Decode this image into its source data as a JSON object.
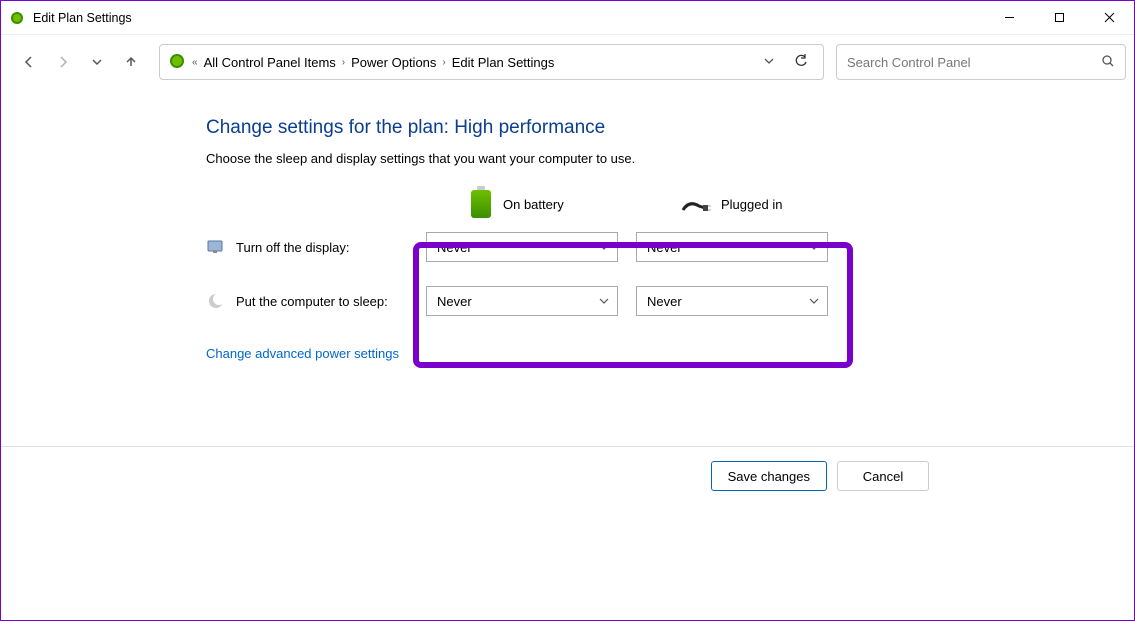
{
  "window": {
    "title": "Edit Plan Settings"
  },
  "breadcrumb": {
    "item1": "All Control Panel Items",
    "item2": "Power Options",
    "item3": "Edit Plan Settings"
  },
  "search": {
    "placeholder": "Search Control Panel"
  },
  "page": {
    "heading": "Change settings for the plan: High performance",
    "sub": "Choose the sleep and display settings that you want your computer to use."
  },
  "columns": {
    "battery": "On battery",
    "plugged": "Plugged in"
  },
  "rows": {
    "display_label": "Turn off the display:",
    "sleep_label": "Put the computer to sleep:"
  },
  "values": {
    "display_battery": "Never",
    "display_plugged": "Never",
    "sleep_battery": "Never",
    "sleep_plugged": "Never"
  },
  "link": "Change advanced power settings",
  "buttons": {
    "save": "Save changes",
    "cancel": "Cancel"
  }
}
